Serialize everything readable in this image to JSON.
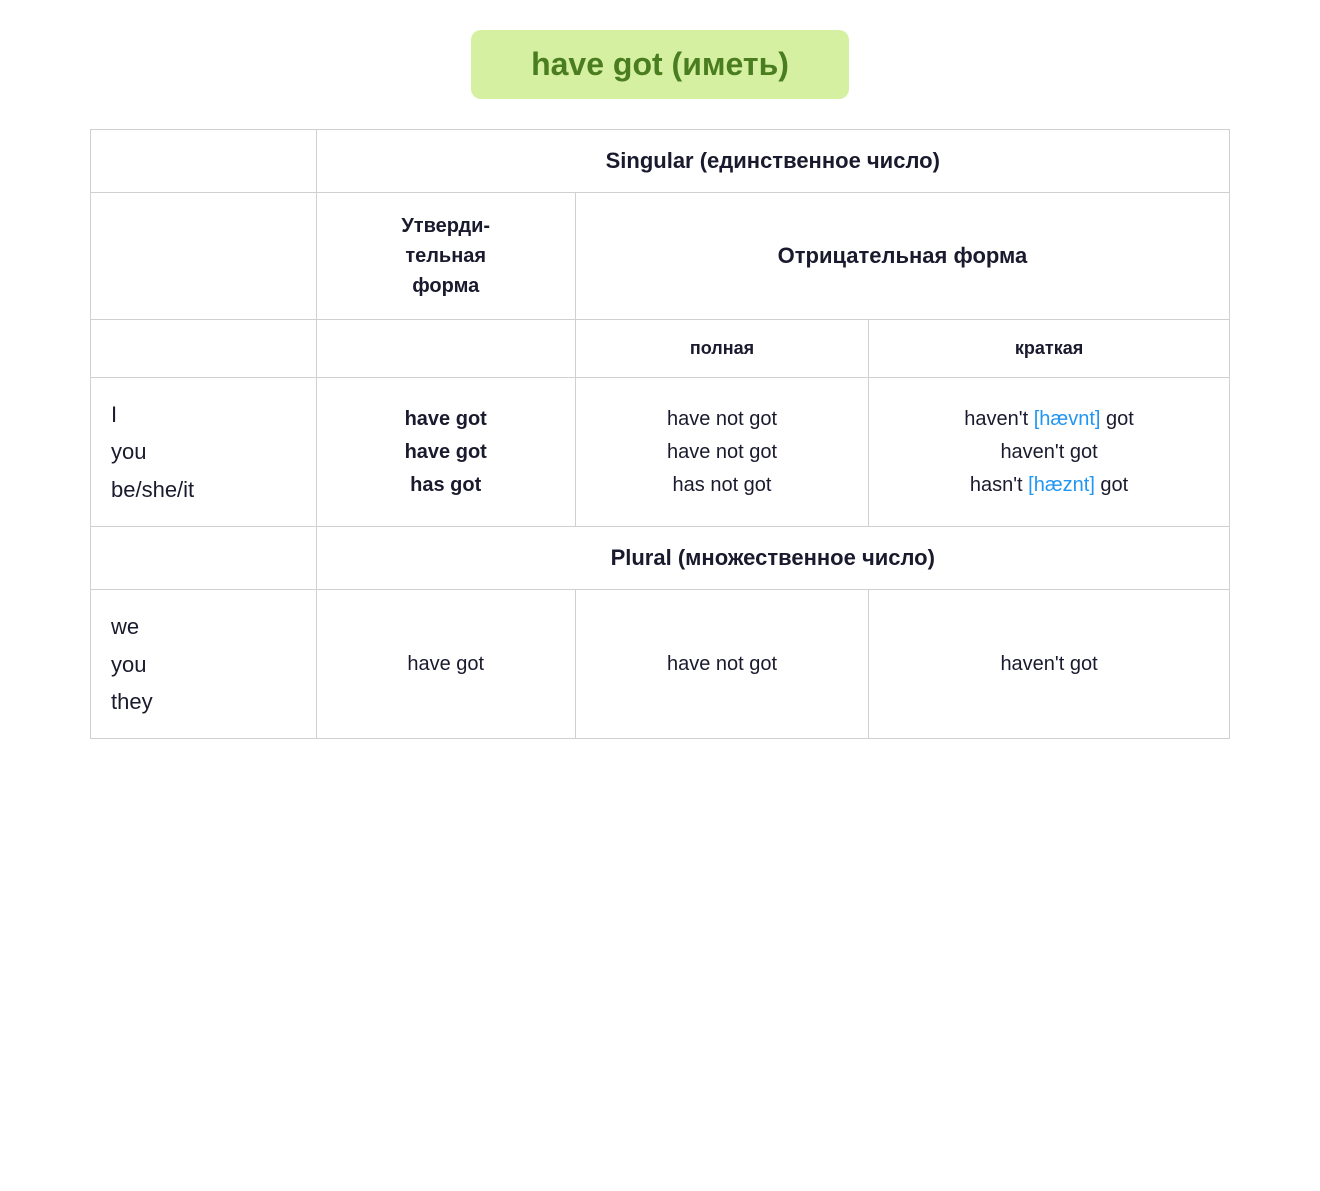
{
  "title": {
    "text": "have got (иметь)",
    "bg_color": "#d4f0a0",
    "text_color": "#4a7c20"
  },
  "table": {
    "singular_header": "Singular (единственное число)",
    "plural_header": "Plural (множественное число)",
    "affirmative_header": "Утверди-тельная форма",
    "negative_header": "Отрицательная форма",
    "full_subheader": "полная",
    "short_subheader": "краткая",
    "singular_rows": [
      {
        "pronoun": "I\nyou\nbe/she/it",
        "affirmative_lines": [
          "have got",
          "have got",
          "has got"
        ],
        "neg_full_lines": [
          "have not got",
          "have not got",
          "has not got"
        ],
        "neg_short_lines": [
          {
            "text": "haven't ",
            "phonetic": "[hævnt]",
            "suffix": " got"
          },
          {
            "text": "haven't got",
            "phonetic": null,
            "suffix": null
          },
          {
            "text": "hasn't ",
            "phonetic": "[hæznt]",
            "suffix": " got"
          }
        ]
      }
    ],
    "plural_rows": [
      {
        "pronoun": "we\nyou\nthey",
        "affirmative": "have got",
        "neg_full": "have not got",
        "neg_short": "haven't got"
      }
    ]
  }
}
